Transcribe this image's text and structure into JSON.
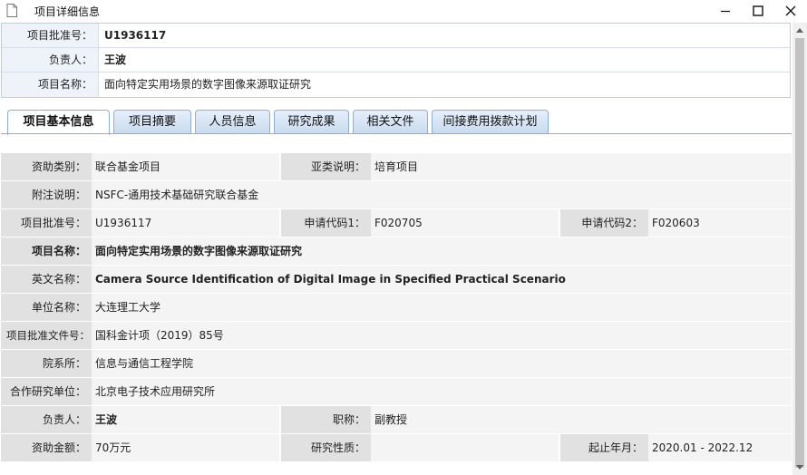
{
  "window": {
    "title": "项目详细信息",
    "icons": {
      "doc": "document-icon",
      "minimize": "minimize-icon",
      "maximize": "maximize-icon",
      "close": "close-icon"
    }
  },
  "header": {
    "rows": [
      {
        "label": "项目批准号：",
        "value": "U1936117",
        "bold": true
      },
      {
        "label": "负责人：",
        "value": "王波",
        "bold": true
      },
      {
        "label": "项目名称：",
        "value": "面向特定实用场景的数字图像来源取证研究",
        "bold": false
      }
    ]
  },
  "tabs": [
    {
      "label": "项目基本信息",
      "active": true
    },
    {
      "label": "项目摘要",
      "active": false
    },
    {
      "label": "人员信息",
      "active": false
    },
    {
      "label": "研究成果",
      "active": false
    },
    {
      "label": "相关文件",
      "active": false
    },
    {
      "label": "间接费用拨款计划",
      "active": false
    }
  ],
  "details": {
    "funding_type_label": "资助类别：",
    "funding_type": "联合基金项目",
    "subtype_label": "亚类说明：",
    "subtype": "培育项目",
    "note_label": "附注说明：",
    "note": "NSFC-通用技术基础研究联合基金",
    "approval_no_label": "项目批准号：",
    "approval_no": "U1936117",
    "apply_code1_label": "申请代码1：",
    "apply_code1": "F020705",
    "apply_code2_label": "申请代码2：",
    "apply_code2": "F020603",
    "project_name_label": "项目名称：",
    "project_name": "面向特定实用场景的数字图像来源取证研究",
    "english_name_label": "英文名称：",
    "english_name": "Camera Source Identification of Digital Image in Specified Practical Scenario",
    "unit_label": "单位名称：",
    "unit": "大连理工大学",
    "approval_doc_label": "项目批准文件号：",
    "approval_doc": "国科金计项（2019）85号",
    "department_label": "院系所：",
    "department": "信息与通信工程学院",
    "partner_label": "合作研究单位：",
    "partner": "北京电子技术应用研究所",
    "pi_label": "负责人：",
    "pi": "王波",
    "title_label": "职称：",
    "title": "副教授",
    "amount_label": "资助金额：",
    "amount": "70万元",
    "nature_label": "研究性质：",
    "nature": "",
    "period_label": "起止年月：",
    "period": "2020.01 - 2022.12"
  }
}
